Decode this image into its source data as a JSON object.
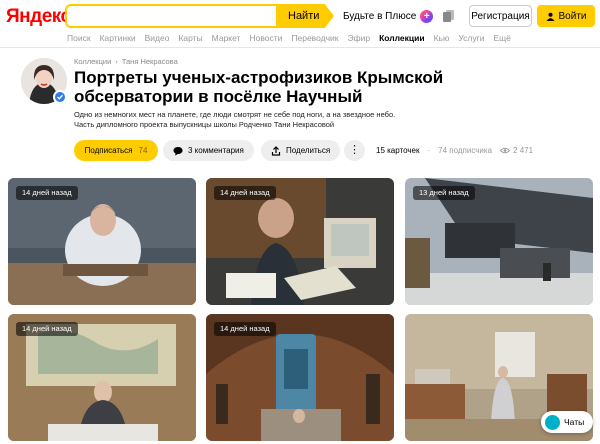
{
  "header": {
    "logo": "Яндекс",
    "search_value": "",
    "search_button": "Найти",
    "plus_label": "Будьте в Плюсе",
    "plus_badge": "+",
    "register_label": "Регистрация",
    "login_label": "Войти"
  },
  "nav": {
    "items": [
      "Поиск",
      "Картинки",
      "Видео",
      "Карты",
      "Маркет",
      "Новости",
      "Переводчик",
      "Эфир",
      "Коллекции",
      "Кью",
      "Услуги",
      "Ещё"
    ],
    "active": "Коллекции"
  },
  "collection": {
    "breadcrumbs": [
      "Коллекции",
      "Таня Некрасова"
    ],
    "title": "Портреты ученых-астрофизиков Крымской обсерватории в посёлке Научный",
    "description_line1": "Одно из немногих мест на планете, где люди смотрят не себе под ноги, а на звездное небо.",
    "description_line2": "Часть дипломного проекта выпускницы школы Родченко Тани Некрасовой"
  },
  "actions": {
    "subscribe_label": "Подписаться",
    "subscribe_count": "74",
    "comments_label": "3 комментария",
    "share_label": "Поделиться",
    "more_label": "⋮"
  },
  "stats": {
    "cards": "15 карточек",
    "subscribers": "74 подписчика",
    "views": "2 471"
  },
  "cards": [
    {
      "badge": "14 дней назад"
    },
    {
      "badge": "14 дней назад"
    },
    {
      "badge": "13 дней назад"
    },
    {
      "badge": "14 дней назад"
    },
    {
      "badge": "14 дней назад"
    },
    {
      "badge": ""
    }
  ],
  "chats_label": "Чаты",
  "colors": {
    "accent": "#ffcc00",
    "logo_red": "#ff0000",
    "verified_blue": "#2c7bf2"
  }
}
